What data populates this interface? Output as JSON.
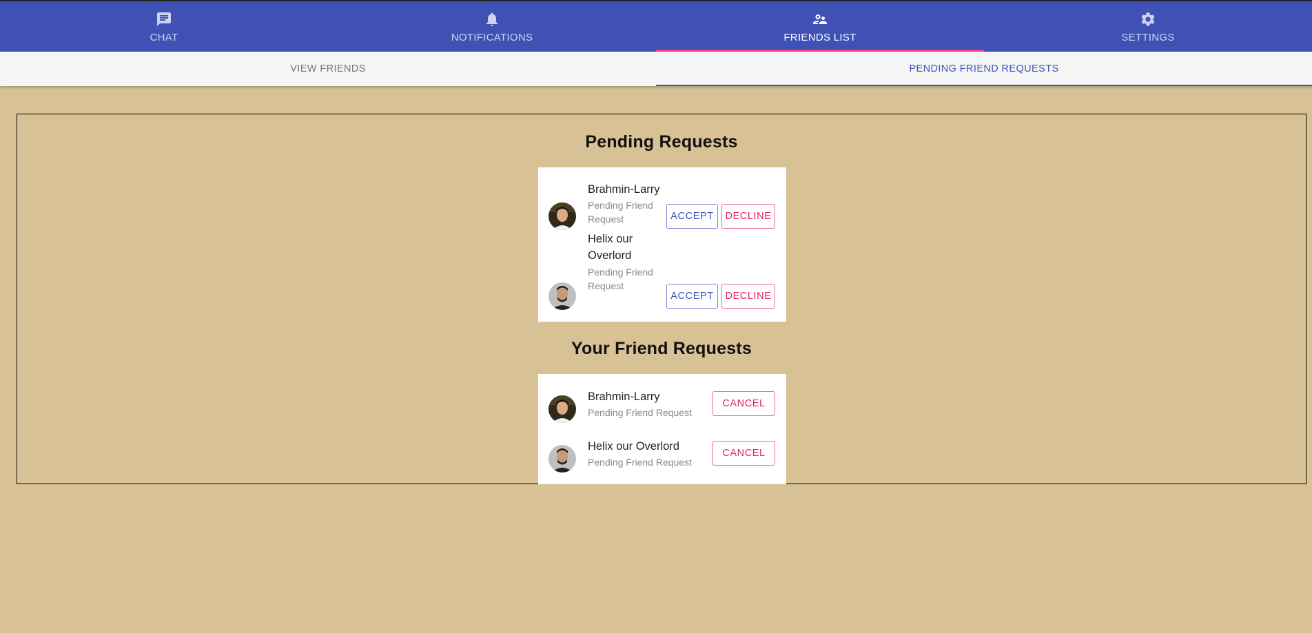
{
  "nav": {
    "tabs": [
      {
        "label": "CHAT",
        "icon": "chat-icon"
      },
      {
        "label": "NOTIFICATIONS",
        "icon": "bell-icon"
      },
      {
        "label": "FRIENDS LIST",
        "icon": "people-icon"
      },
      {
        "label": "SETTINGS",
        "icon": "gear-icon"
      }
    ],
    "active_index": 2
  },
  "subnav": {
    "tabs": [
      {
        "label": "VIEW FRIENDS"
      },
      {
        "label": "PENDING FRIEND REQUESTS"
      }
    ],
    "active_index": 1
  },
  "pending": {
    "title": "Pending Requests",
    "items": [
      {
        "name_line1": "Brahmin-Larry",
        "name_line2": "",
        "status_line1": "Pending Friend",
        "status_line2": "Request",
        "accept_label": "ACCEPT",
        "decline_label": "DECLINE"
      },
      {
        "name_line1": "Helix our",
        "name_line2": "Overlord",
        "status_line1": "Pending Friend",
        "status_line2": "Request",
        "accept_label": "ACCEPT",
        "decline_label": "DECLINE"
      }
    ]
  },
  "outgoing": {
    "title": "Your Friend Requests",
    "items": [
      {
        "name": "Brahmin-Larry",
        "status": "Pending Friend Request",
        "cancel_label": "CANCEL"
      },
      {
        "name": "Helix our Overlord",
        "status": "Pending Friend Request",
        "cancel_label": "CANCEL"
      }
    ]
  },
  "colors": {
    "primary": "#3f51b5",
    "accent": "#ff4081",
    "background": "#d8c295"
  }
}
